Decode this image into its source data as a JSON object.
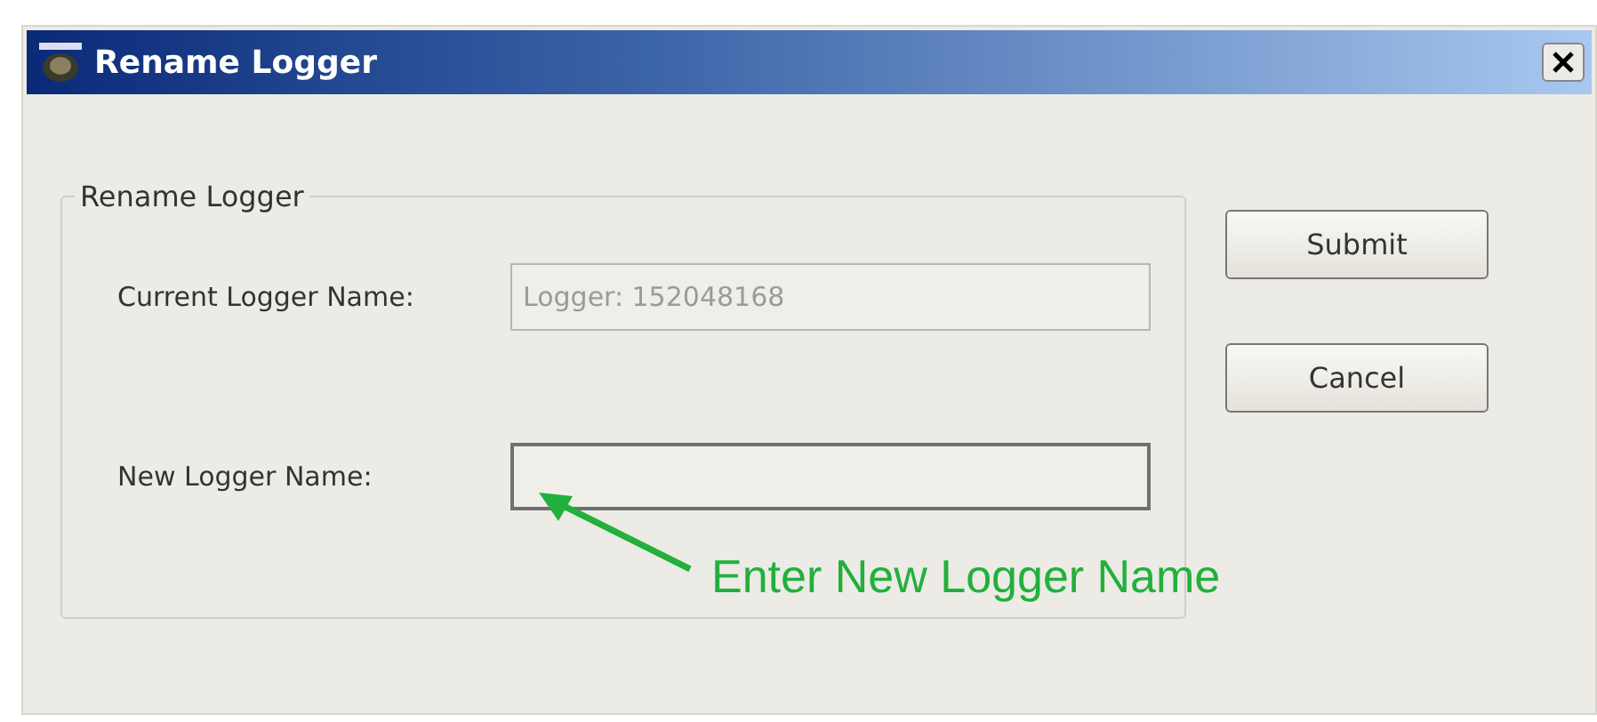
{
  "window": {
    "title": "Rename Logger"
  },
  "group": {
    "title": "Rename Logger"
  },
  "fields": [
    {
      "label": "Current Logger Name:",
      "value": "Logger: 152048168",
      "disabled": true
    },
    {
      "label": "New Logger Name:",
      "disabled": false
    }
  ],
  "buttons": [
    "Submit",
    "Cancel"
  ],
  "annotation": {
    "text": "Enter New Logger Name"
  }
}
